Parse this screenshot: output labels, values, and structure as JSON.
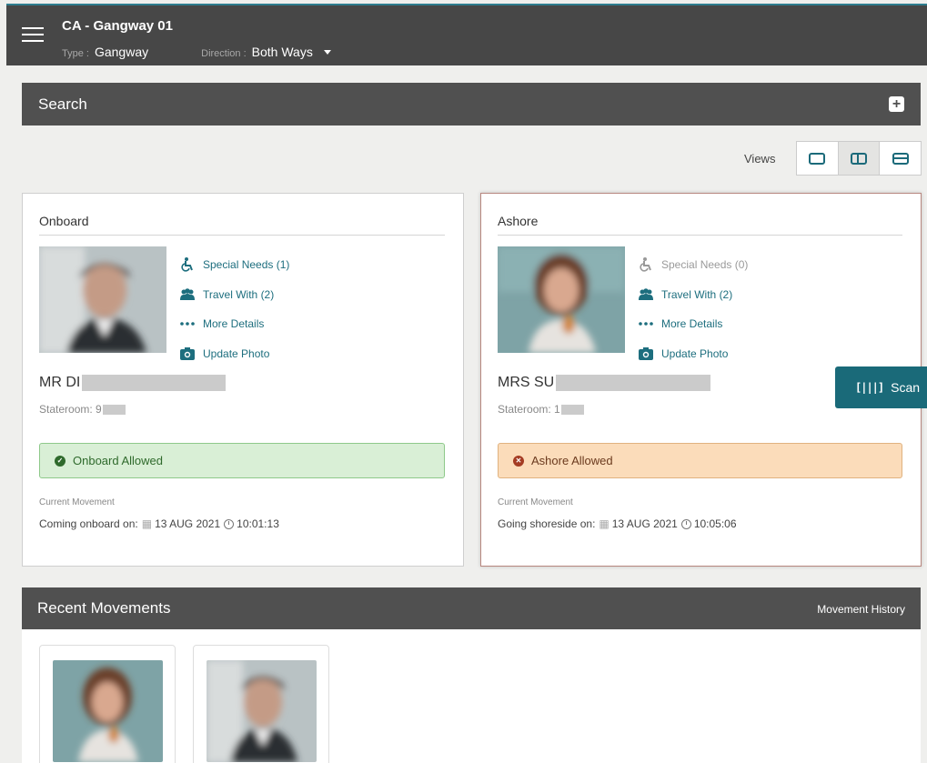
{
  "header": {
    "title": "CA - Gangway 01",
    "type_label": "Type :",
    "type_value": "Gangway",
    "direction_label": "Direction :",
    "direction_value": "Both Ways"
  },
  "search": {
    "label": "Search"
  },
  "views": {
    "label": "Views",
    "options": [
      "single",
      "split-vertical",
      "split-horizontal"
    ],
    "selected": "split-vertical"
  },
  "cards": [
    {
      "title": "Onboard",
      "links": {
        "special_needs": "Special Needs (1)",
        "travel_with": "Travel With (2)",
        "more_details": "More Details",
        "update_photo": "Update Photo"
      },
      "name_prefix": "MR DI",
      "stateroom_prefix": "Stateroom: 9",
      "status": "Onboard Allowed",
      "current_movement_label": "Current Movement",
      "movement_text": "Coming onboard on:",
      "date": "13 AUG 2021",
      "time": "10:01:13"
    },
    {
      "title": "Ashore",
      "links": {
        "special_needs": "Special Needs (0)",
        "travel_with": "Travel With (2)",
        "more_details": "More Details",
        "update_photo": "Update Photo"
      },
      "name_prefix": "MRS SU",
      "stateroom_prefix": "Stateroom: 1",
      "status": "Ashore Allowed",
      "current_movement_label": "Current Movement",
      "movement_text": "Going shoreside on:",
      "date": "13 AUG 2021",
      "time": "10:05:06"
    }
  ],
  "scan": {
    "label": "Scan"
  },
  "recent": {
    "title": "Recent Movements",
    "history_link": "Movement History"
  },
  "colors": {
    "accent": "#1a6a79",
    "header_bg": "#474747",
    "bar_bg": "#505050",
    "ok_bg": "#d9efd6",
    "warn_bg": "#fbdcba"
  }
}
